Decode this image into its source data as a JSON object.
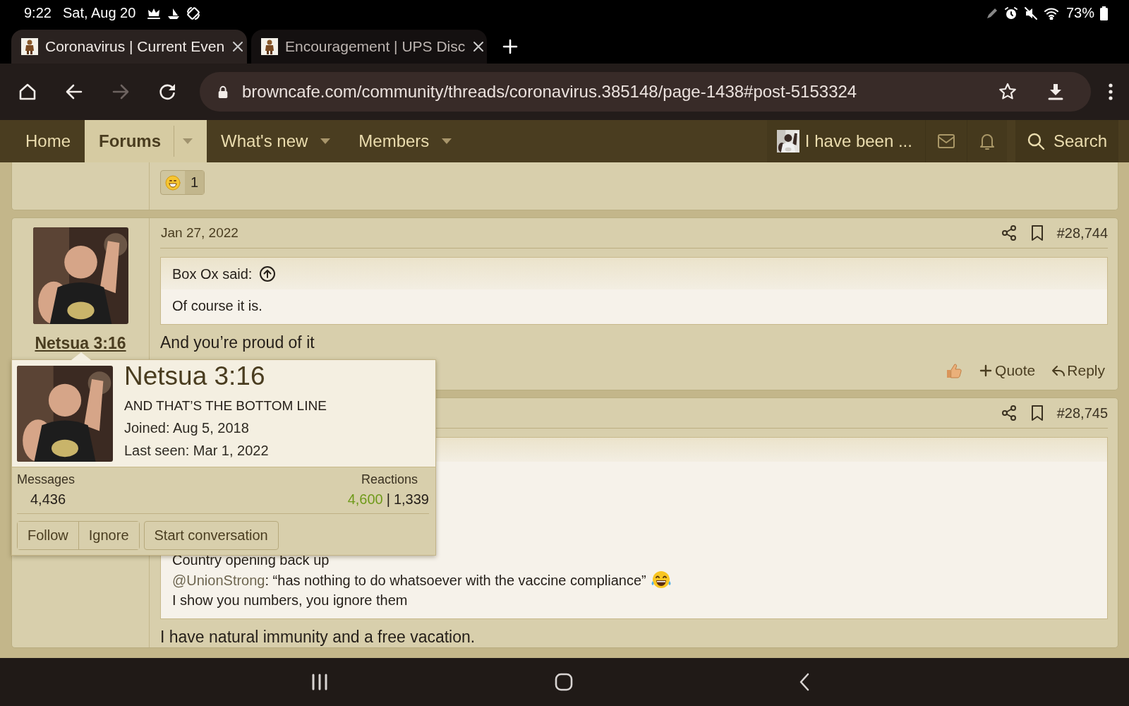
{
  "status_bar": {
    "time": "9:22",
    "date": "Sat, Aug 20",
    "battery": "73%"
  },
  "browser": {
    "tabs": [
      {
        "title": "Coronavirus | Current Even",
        "selected": true
      },
      {
        "title": "Encouragement | UPS Disc",
        "selected": false
      }
    ],
    "url": "browncafe.com/community/threads/coronavirus.385148/page-1438#post-5153324",
    "forward_disabled": true
  },
  "nav": {
    "items": [
      {
        "label": "Home",
        "selected": false,
        "dropdown": false
      },
      {
        "label": "Forums",
        "selected": true,
        "dropdown": true
      },
      {
        "label": "What's new",
        "selected": false,
        "dropdown": true
      },
      {
        "label": "Members",
        "selected": false,
        "dropdown": true
      }
    ],
    "account": "I have been ...",
    "search": "Search"
  },
  "posts": [
    {
      "kind": "tail",
      "reaction_count": "1"
    },
    {
      "kind": "full",
      "author": "Netsua 3:16",
      "date": "Jan 27, 2022",
      "number": "#28,744",
      "quote": {
        "author": "Box Ox said:",
        "lines": [
          {
            "text": "Of course it is."
          }
        ]
      },
      "body": "And you’re proud of it",
      "actions": [
        {
          "kind": "quote",
          "label": "Quote"
        },
        {
          "kind": "reply",
          "label": "Reply"
        }
      ]
    },
    {
      "kind": "full",
      "number": "#28,745",
      "quote": {
        "lines": [
          {
            "text": "Country opening back up"
          },
          {
            "mention": "@UnionStrong",
            "text": ": “has nothing to do whatsoever with the vaccine compliance”",
            "emoji": true
          },
          {
            "text": "I show you numbers, you ignore them"
          }
        ]
      },
      "body": "I have natural immunity and a free vacation."
    }
  ],
  "member_card": {
    "name": "Netsua 3:16",
    "title": "AND THAT’S THE BOTTOM LINE",
    "joined": "Joined: Aug 5, 2018",
    "last_seen": "Last seen: Mar 1, 2022",
    "messages_label": "Messages",
    "messages": "4,436",
    "reactions_label": "Reactions",
    "reactions_positive": "4,600",
    "reactions_separator": "|",
    "reactions_other": "1,339",
    "buttons": [
      {
        "label": "Follow",
        "grouped": true
      },
      {
        "label": "Ignore",
        "grouped": true
      },
      {
        "label": "Start conversation",
        "grouped": false
      }
    ]
  }
}
